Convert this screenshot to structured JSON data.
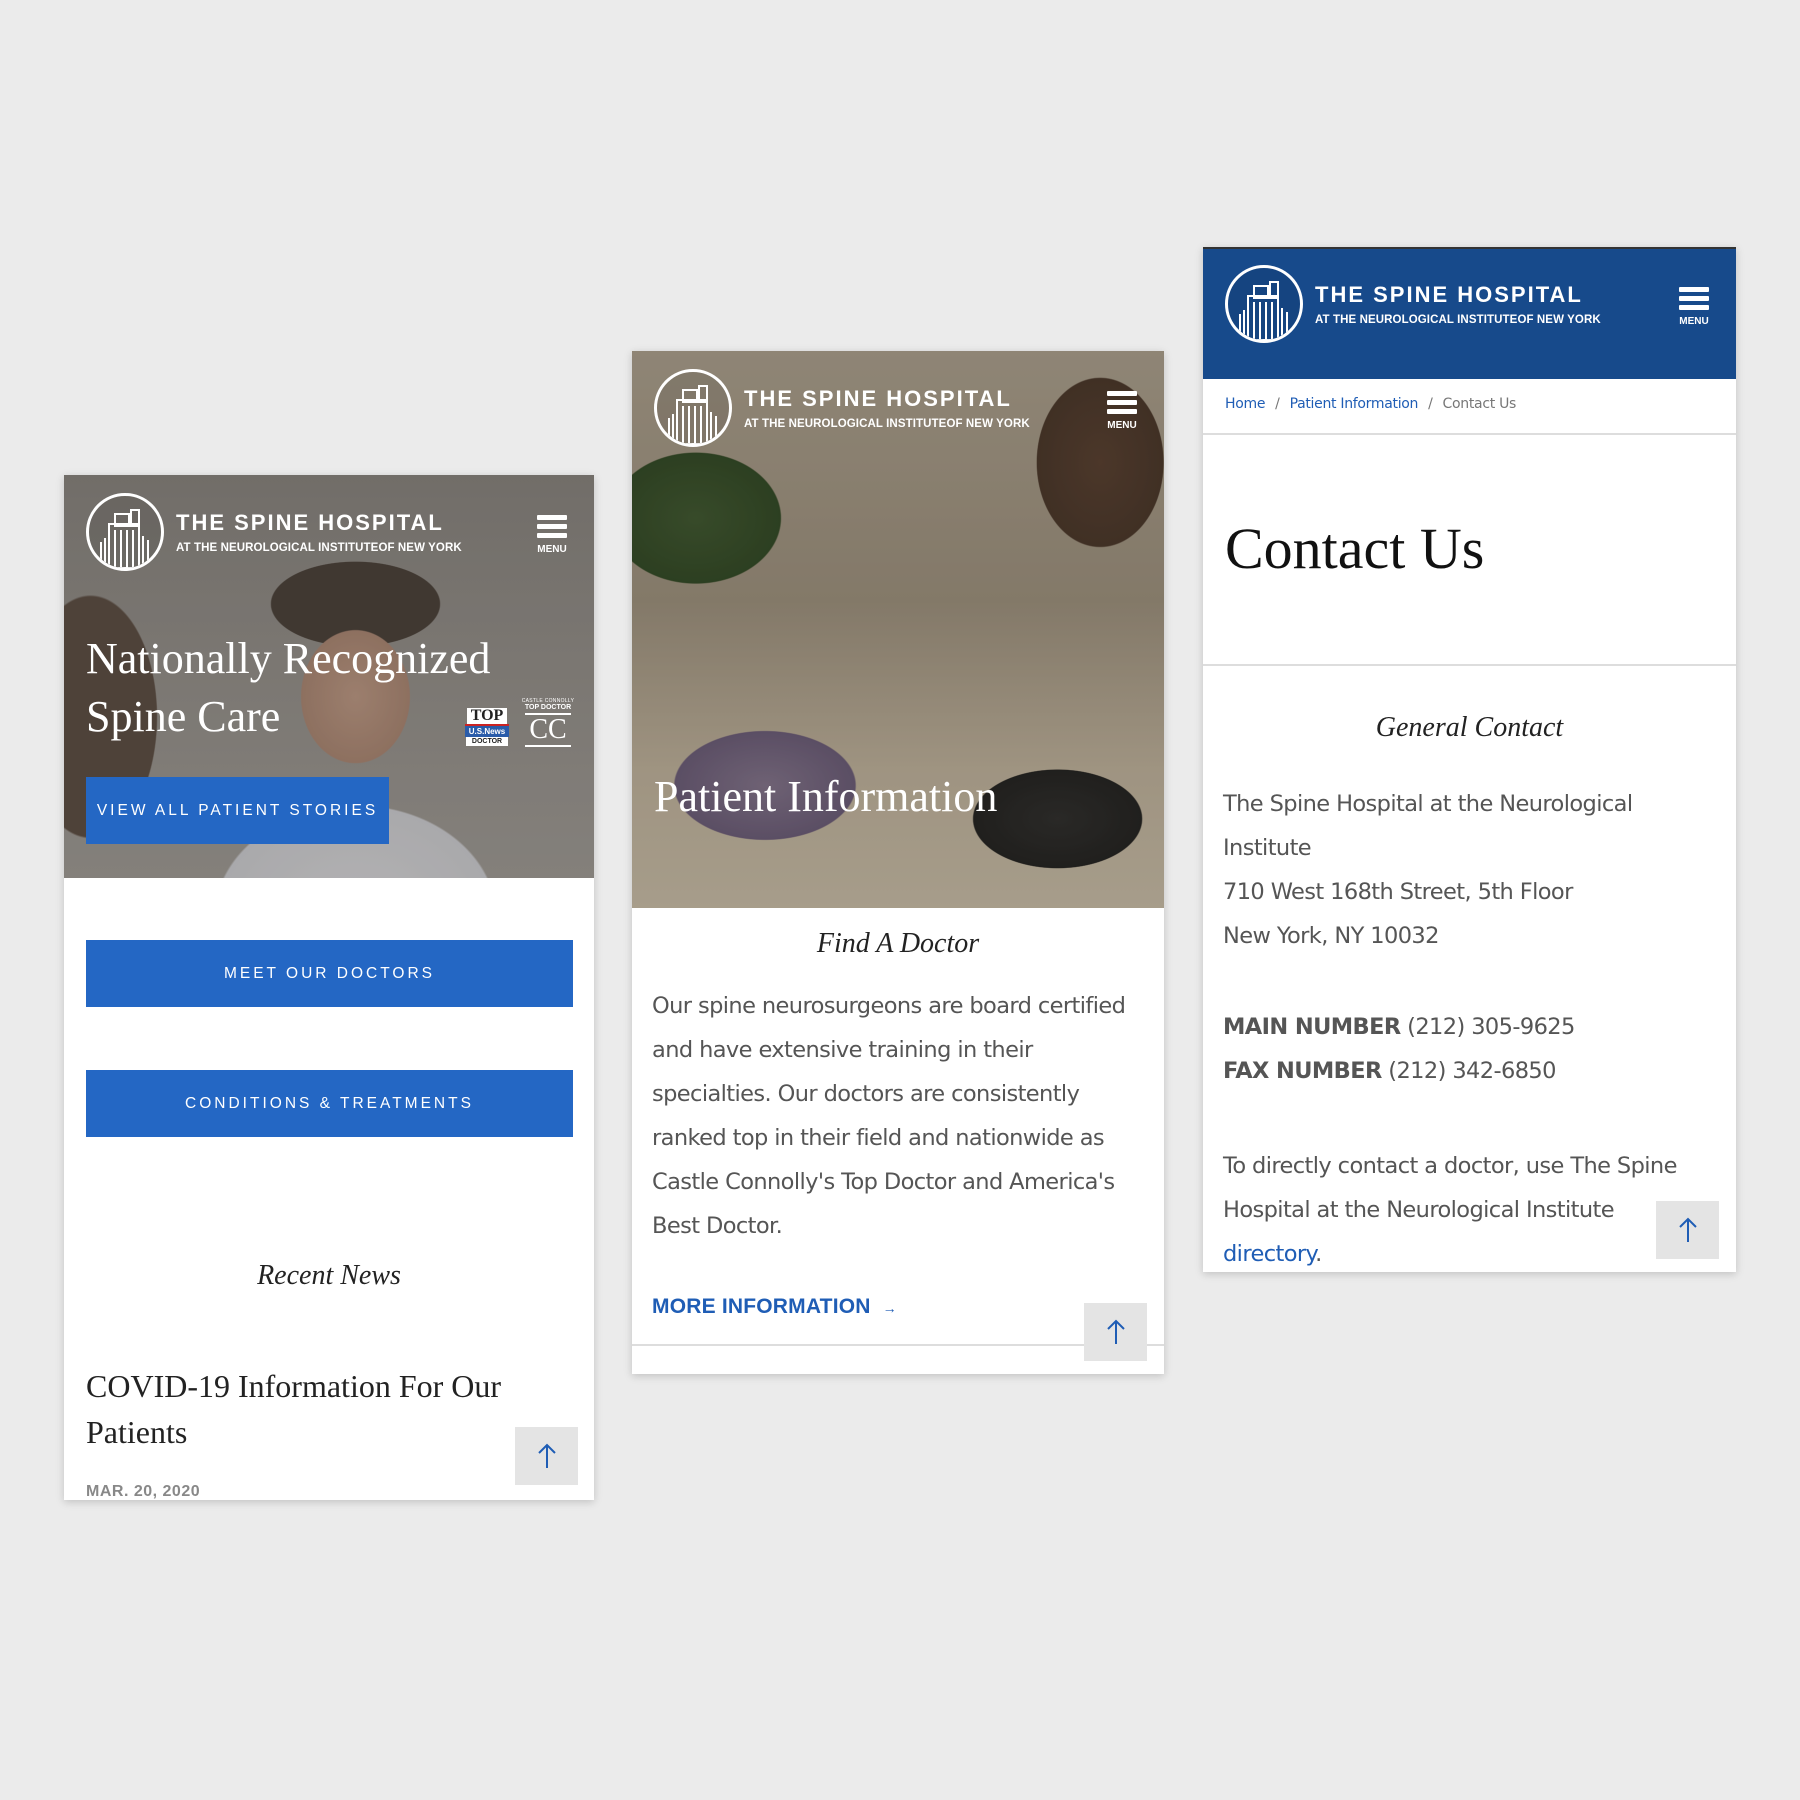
{
  "brand": {
    "title": "THE SPINE HOSPITAL",
    "subtitle": "AT THE NEUROLOGICAL INSTITUTEOF NEW YORK",
    "menu_label": "MENU",
    "colors": {
      "primary_blue": "#2467c4",
      "header_navy": "#174a8b",
      "link_blue": "#1f5db5",
      "background": "#ebebeb"
    }
  },
  "home": {
    "hero_title_line1": "Nationally Recognized",
    "hero_title_line2": "Spine Care",
    "badges": {
      "usnews_top": "TOP",
      "usnews_name": "U.S.News",
      "usnews_doctor": "DOCTOR",
      "castle_small": "CASTLE CONNOLLY",
      "castle_top": "TOP DOCTOR",
      "castle_mark": "CC"
    },
    "stories_button": "VIEW ALL PATIENT STORIES",
    "doctors_button": "MEET OUR DOCTORS",
    "conditions_button": "CONDITIONS & TREATMENTS",
    "recent_news_heading": "Recent News",
    "news_item": {
      "title": "COVID-19 Information For Our Patients",
      "date": "MAR. 20, 2020"
    }
  },
  "patient": {
    "hero_title": "Patient Information",
    "section_heading": "Find A Doctor",
    "body": "Our spine neurosurgeons are board certified and have extensive training in their specialties. Our doctors are consistently ranked top in their field and nationwide as Castle Connolly's Top Doctor and America's Best Doctor.",
    "more_link": "MORE INFORMATION",
    "more_arrow": "→"
  },
  "contact": {
    "breadcrumb": [
      {
        "label": "Home"
      },
      {
        "label": "Patient Information"
      },
      {
        "label": "Contact Us"
      }
    ],
    "breadcrumb_sep": "/",
    "page_title": "Contact Us",
    "section_heading": "General Contact",
    "address_line1": "The Spine Hospital at the Neurological Institute",
    "address_line2": "710 West 168th Street, 5th Floor",
    "address_line3": "New York, NY 10032",
    "main_label": "MAIN NUMBER",
    "main_number": "(212) 305-9625",
    "fax_label": "FAX NUMBER",
    "fax_number": "(212) 342-6850",
    "directory_text": "To directly contact a doctor, use The Spine Hospital at the Neurological Institute ",
    "directory_link": "directory",
    "directory_end": "."
  }
}
